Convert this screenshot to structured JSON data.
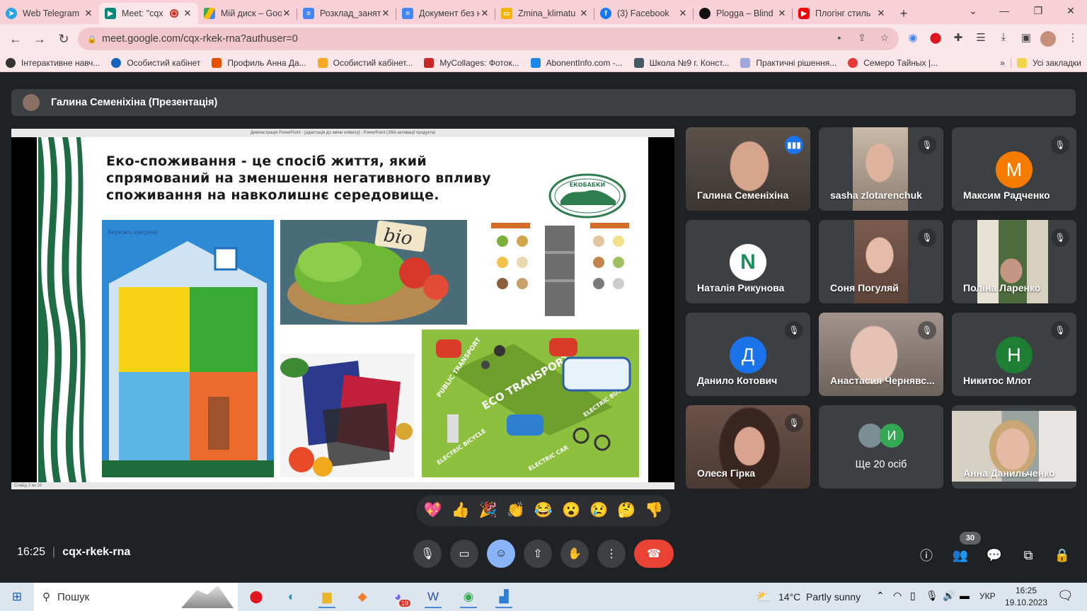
{
  "browser": {
    "tabs": [
      {
        "title": "Web Telegram",
        "icon": "telegram-icon",
        "color": "#2aa3e0"
      },
      {
        "title": "Meet: \"cqx",
        "icon": "meet-icon",
        "color": "#00897b",
        "active": true,
        "recording": true
      },
      {
        "title": "Мій диск – Google",
        "icon": "drive-icon",
        "color": "#fbbc04"
      },
      {
        "title": "Розклад_занять",
        "icon": "docs-icon",
        "color": "#4285f4"
      },
      {
        "title": "Документ без назви",
        "icon": "docs-icon",
        "color": "#4285f4"
      },
      {
        "title": "Zmina_klimatu",
        "icon": "slides-icon",
        "color": "#f4b400"
      },
      {
        "title": "(3) Facebook",
        "icon": "facebook-icon",
        "color": "#1877f2"
      },
      {
        "title": "Plogga – Blind",
        "icon": "plogga-icon",
        "color": "#111111"
      },
      {
        "title": "Плогінг стиль",
        "icon": "youtube-icon",
        "color": "#ff0000"
      }
    ],
    "new_tab": "+",
    "url": "meet.google.com/cqx-rkek-rna?authuser=0",
    "bookmarks": [
      {
        "label": "Інтерактивне навч...",
        "color": "#333333"
      },
      {
        "label": "Особистий кабінет",
        "color": "#1565c0"
      },
      {
        "label": "Профиль Анна Да...",
        "color": "#e65100"
      },
      {
        "label": "Особистий кабінет...",
        "color": "#f9a825"
      },
      {
        "label": "MyCollages: Фоток...",
        "color": "#c62828"
      },
      {
        "label": "AbonentInfo.com -...",
        "color": "#1e88e5"
      },
      {
        "label": "Школа №9 г. Конст...",
        "color": "#455a64"
      },
      {
        "label": "Практичні рішення...",
        "color": "#9fa8da"
      },
      {
        "label": "Семеро Тайных |...",
        "color": "#e53935"
      }
    ],
    "bookmarks_more": "»",
    "all_bookmarks": "Усі закладки"
  },
  "meet": {
    "presenter_label": "Галина Семеніхіна (Презентація)",
    "ppt_title": "Демонстрація PowerPoint - [адаптація до зміни клімату] - PowerPoint (Збій активації продукта)",
    "ppt_footer": "Слайд 2 из 10",
    "slide": {
      "title": "Еко-споживання - це спосіб життя, який спрямований на зменшення негативного впливу споживання на навколишнє середовище.",
      "logo_text": "ЕКОБАБКИ",
      "bio_label": "bio",
      "eco_transport_label": "ECO TRANSPORT",
      "public_transport_label": "PUBLIC TRANSPORT",
      "electric_bus_label": "ELECTRIC BUS",
      "electric_bicycle_label": "ELECTRIC BICYCLE",
      "electric_car_label": "ELECTRIC CAR"
    },
    "participants": [
      {
        "name": "Галина Семеніхіна",
        "speaking": true,
        "muted": false,
        "type": "video",
        "bg": "#4d4540"
      },
      {
        "name": "sasha zlotarenchuk",
        "muted": true,
        "type": "video",
        "bg": "#8f7f73"
      },
      {
        "name": "Максим Радченко",
        "muted": true,
        "type": "avatar",
        "letter": "М",
        "color": "#f57c00"
      },
      {
        "name": "Наталія Рикунова",
        "muted": false,
        "type": "avatar",
        "letter": "N",
        "color": "#ffffff"
      },
      {
        "name": "Соня Погуляй",
        "muted": true,
        "type": "video",
        "bg": "#6b4f44"
      },
      {
        "name": "Поліна Ларенко",
        "muted": true,
        "type": "video",
        "bg": "#5b6950"
      },
      {
        "name": "Данило Котович",
        "muted": true,
        "type": "avatar",
        "letter": "Д",
        "color": "#1a73e8"
      },
      {
        "name": "Анастасия Чернявс...",
        "muted": true,
        "type": "video",
        "bg": "#8a7b74"
      },
      {
        "name": "Никитос Млот",
        "muted": true,
        "type": "avatar",
        "letter": "Н",
        "color": "#1e7e34"
      },
      {
        "name": "Олеся Гірка",
        "muted": true,
        "type": "video",
        "bg": "#6c5248"
      },
      {
        "name": "Ще 20 осіб",
        "type": "more",
        "letter": "И",
        "color": "#34a853"
      },
      {
        "name": "Анна Данильченко",
        "muted": false,
        "type": "video",
        "bg": "#8b8373"
      }
    ],
    "reactions": [
      "💖",
      "👍",
      "🎉",
      "👏",
      "😂",
      "😮",
      "😢",
      "🤔",
      "👎"
    ],
    "time": "16:25",
    "meeting_code": "cqx-rkek-rna",
    "participants_badge": "30"
  },
  "taskbar": {
    "search_placeholder": "Пошук",
    "weather": "14°C  Partly sunny",
    "language": "УКР",
    "clock_time": "16:25",
    "clock_date": "19.10.2023",
    "viber_badge": "19"
  }
}
